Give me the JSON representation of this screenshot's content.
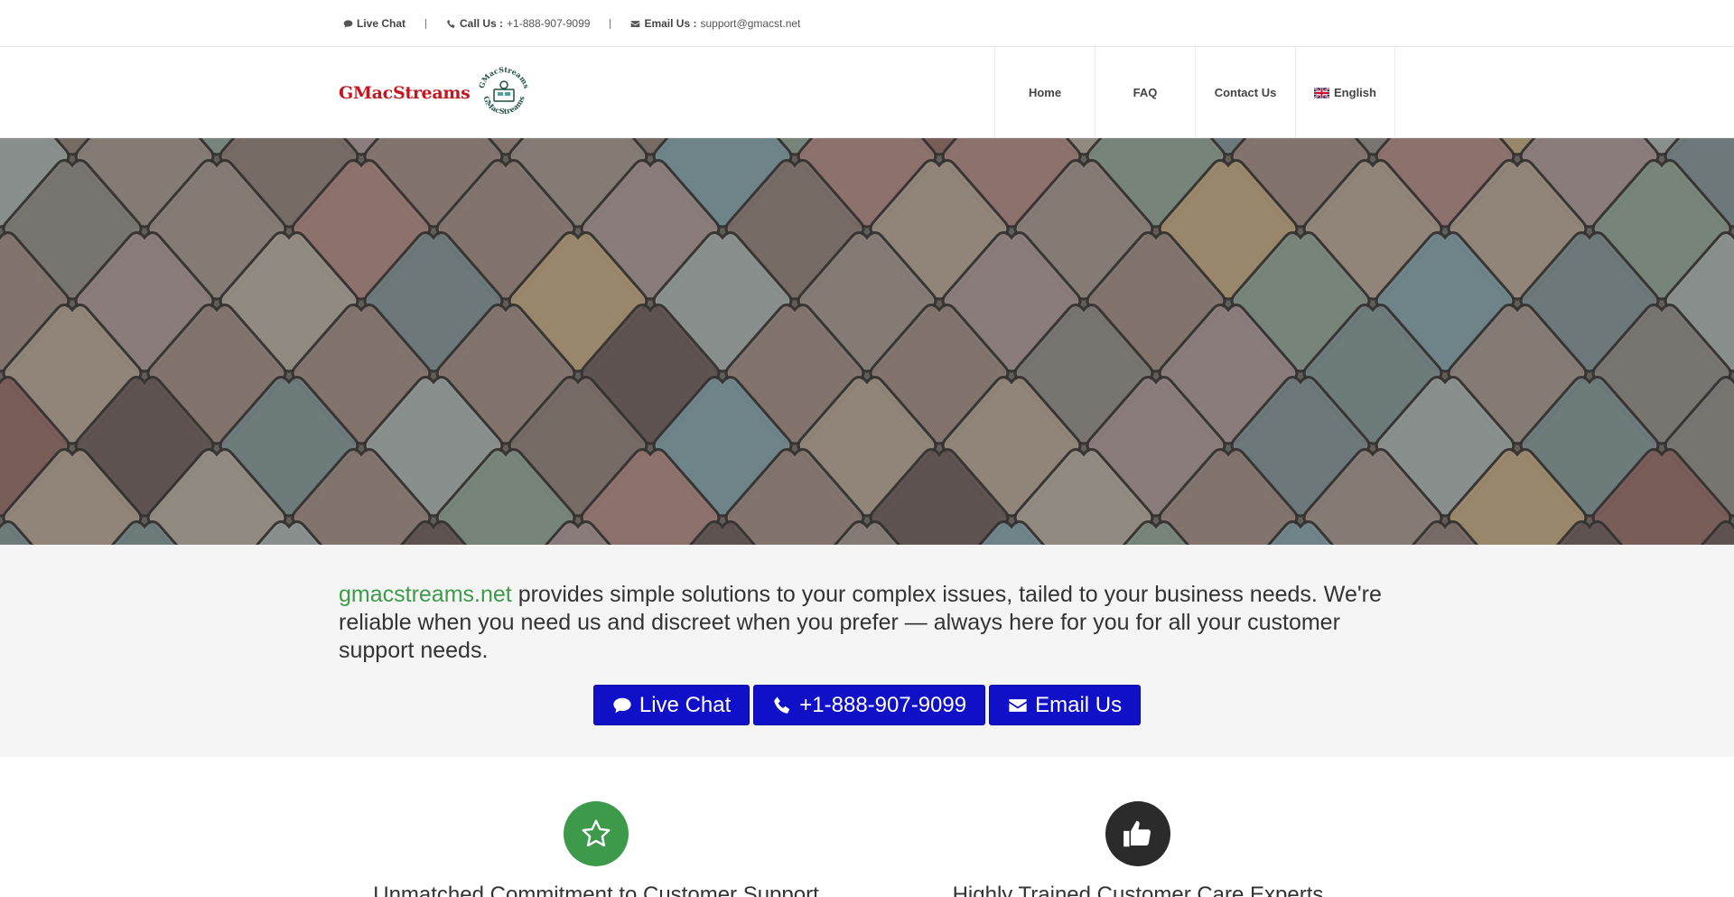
{
  "topbar": {
    "live_chat": "Live Chat",
    "call_label": "Call Us :",
    "call_value": "+1-888-907-9099",
    "email_label": "Email Us :",
    "email_value": "support@gmacst.net",
    "icons": [
      "chat-icon",
      "phone-icon",
      "envelope-icon"
    ]
  },
  "header": {
    "logo_text": "GMacStreams",
    "logo_ring_text": "GMacStreams",
    "nav": [
      {
        "label": "Home"
      },
      {
        "label": "FAQ"
      },
      {
        "label": "Contact Us"
      },
      {
        "label": "English",
        "icon": "uk-flag-icon"
      }
    ]
  },
  "intro": {
    "brand": "gmacstreams.net",
    "text": " provides simple solutions to your complex issues, tailed to your business needs. We're reliable when you need us and discreet when you prefer — always here for you for all your customer support needs.",
    "buttons": [
      {
        "label": "Live Chat",
        "icon": "chat-icon"
      },
      {
        "label": "+1-888-907-9099",
        "icon": "phone-icon"
      },
      {
        "label": "Email Us",
        "icon": "envelope-icon"
      }
    ]
  },
  "features": [
    {
      "title": "Unmatched Commitment to Customer Support",
      "icon": "star-icon",
      "color": "#3e9a4b"
    },
    {
      "title": "Highly Trained Customer Care Experts",
      "icon": "thumbs-up-icon",
      "color": "#2b2b2b"
    }
  ],
  "colors": {
    "brand_red": "#c4161c",
    "brand_green": "#3e9a4b",
    "cta_blue": "#1010c8"
  }
}
